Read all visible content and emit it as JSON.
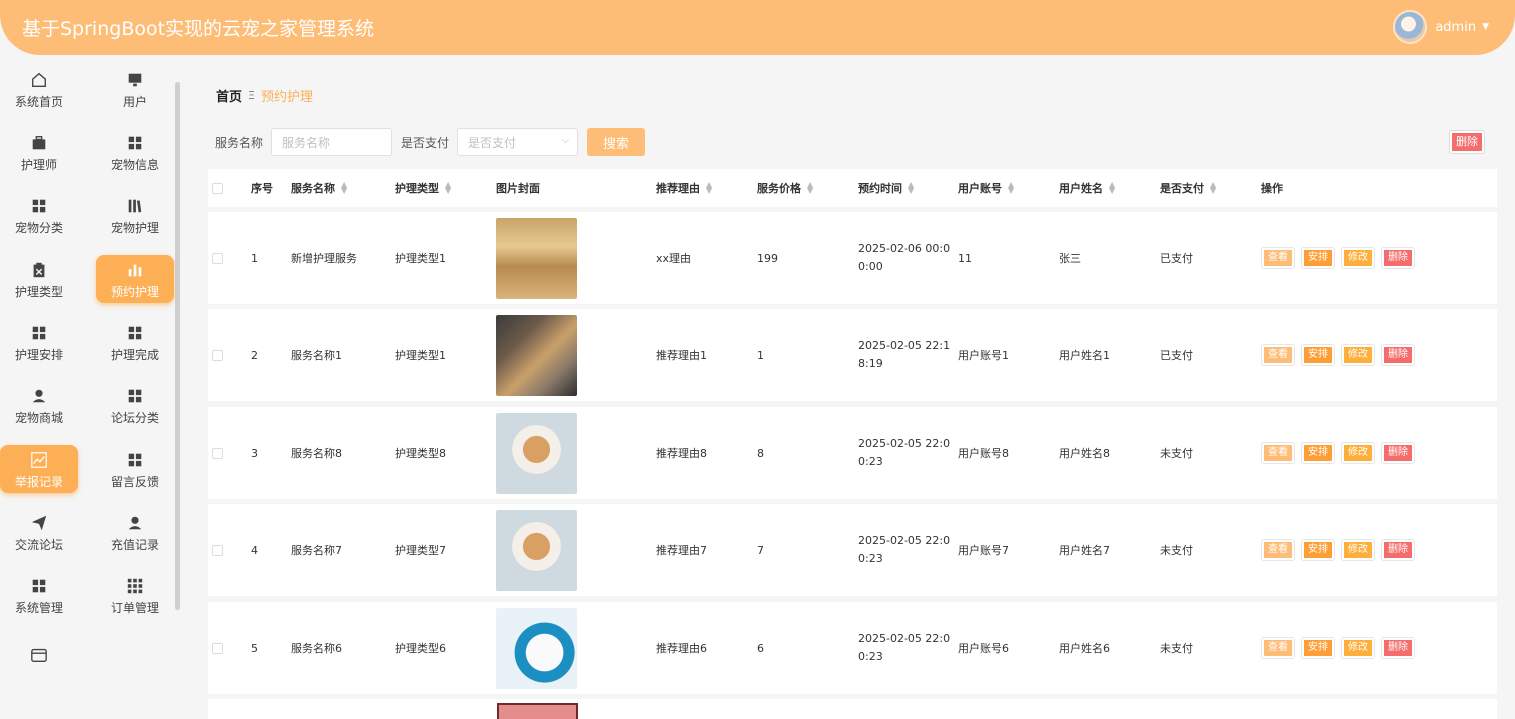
{
  "app": {
    "title": "基于SpringBoot实现的云宠之家管理系统"
  },
  "user": {
    "name": "admin"
  },
  "sidebar": {
    "items": [
      {
        "label": "系统首页",
        "icon": "home-icon"
      },
      {
        "label": "用户",
        "icon": "monitor-icon"
      },
      {
        "label": "护理师",
        "icon": "briefcase-icon"
      },
      {
        "label": "宠物信息",
        "icon": "grid-icon"
      },
      {
        "label": "宠物分类",
        "icon": "grid-icon"
      },
      {
        "label": "宠物护理",
        "icon": "books-icon"
      },
      {
        "label": "护理类型",
        "icon": "clipboard-icon"
      },
      {
        "label": "预约护理",
        "icon": "bar-chart-icon"
      },
      {
        "label": "护理安排",
        "icon": "grid-icon"
      },
      {
        "label": "护理完成",
        "icon": "grid-icon"
      },
      {
        "label": "宠物商城",
        "icon": "user-icon"
      },
      {
        "label": "论坛分类",
        "icon": "grid-icon"
      },
      {
        "label": "举报记录",
        "icon": "line-chart-icon"
      },
      {
        "label": "留言反馈",
        "icon": "grid-icon"
      },
      {
        "label": "交流论坛",
        "icon": "send-icon"
      },
      {
        "label": "充值记录",
        "icon": "user-icon"
      },
      {
        "label": "系统管理",
        "icon": "grid-icon"
      },
      {
        "label": "订单管理",
        "icon": "grid-9-icon"
      },
      {
        "label": "",
        "icon": "wallet-icon"
      }
    ]
  },
  "breadcrumb": {
    "home": "首页",
    "separator": "Ξ",
    "current": "预约护理"
  },
  "search": {
    "name_label": "服务名称",
    "name_placeholder": "服务名称",
    "paid_label": "是否支付",
    "paid_placeholder": "是否支付",
    "search_button": "搜索",
    "delete_button": "删除"
  },
  "table": {
    "columns": [
      "序号",
      "服务名称",
      "护理类型",
      "图片封面",
      "推荐理由",
      "服务价格",
      "预约时间",
      "用户账号",
      "用户姓名",
      "是否支付",
      "操作"
    ],
    "rows": [
      {
        "index": "1",
        "service_name": "新增护理服务",
        "care_type": "护理类型1",
        "reason": "xx理由",
        "price": "199",
        "time": "2025-02-06 00:00:00",
        "account": "11",
        "user_name": "张三",
        "paid": "已支付"
      },
      {
        "index": "2",
        "service_name": "服务名称1",
        "care_type": "护理类型1",
        "reason": "推荐理由1",
        "price": "1",
        "time": "2025-02-05 22:18:19",
        "account": "用户账号1",
        "user_name": "用户姓名1",
        "paid": "已支付"
      },
      {
        "index": "3",
        "service_name": "服务名称8",
        "care_type": "护理类型8",
        "reason": "推荐理由8",
        "price": "8",
        "time": "2025-02-05 22:00:23",
        "account": "用户账号8",
        "user_name": "用户姓名8",
        "paid": "未支付"
      },
      {
        "index": "4",
        "service_name": "服务名称7",
        "care_type": "护理类型7",
        "reason": "推荐理由7",
        "price": "7",
        "time": "2025-02-05 22:00:23",
        "account": "用户账号7",
        "user_name": "用户姓名7",
        "paid": "未支付"
      },
      {
        "index": "5",
        "service_name": "服务名称6",
        "care_type": "护理类型6",
        "reason": "推荐理由6",
        "price": "6",
        "time": "2025-02-05 22:00:23",
        "account": "用户账号6",
        "user_name": "用户姓名6",
        "paid": "未支付"
      }
    ],
    "actions": {
      "view": "查看",
      "arrange": "安排",
      "edit": "修改",
      "delete": "删除"
    }
  },
  "colors": {
    "accent": "#fdbd77",
    "active": "#fdaf55",
    "danger": "#f56c6c"
  }
}
